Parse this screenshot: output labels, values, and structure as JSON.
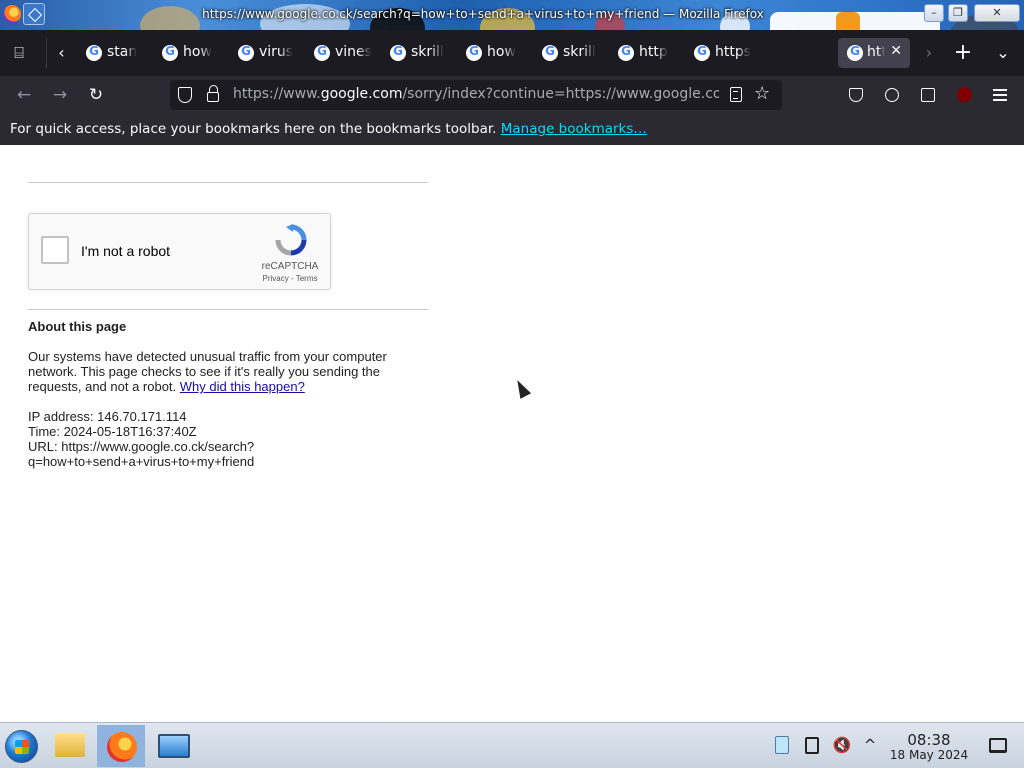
{
  "window": {
    "title": "https://www.google.co.ck/search?q=how+to+send+a+virus+to+my+friend — Mozilla Firefox",
    "minimize_label": "–",
    "maximize_label": "❐",
    "close_label": "✕"
  },
  "tabs": [
    {
      "label": "stan"
    },
    {
      "label": "how"
    },
    {
      "label": "virus"
    },
    {
      "label": "vines"
    },
    {
      "label": "skrill"
    },
    {
      "label": "how"
    },
    {
      "label": "skrill"
    },
    {
      "label": "http"
    },
    {
      "label": "https"
    }
  ],
  "active_tab": {
    "label": "htt",
    "close_label": "✕"
  },
  "tab_strip": {
    "list_all_label": "⌸",
    "scroll_left_label": "‹",
    "scroll_right_label": "›",
    "new_tab_label": "+",
    "overflow_label": "⌄"
  },
  "nav": {
    "back_label": "←",
    "forward_label": "→",
    "reload_label": "↻",
    "url_prefix": "https://www.",
    "url_host": "google.com",
    "url_rest": "/sorry/index?continue=https://www.google.co",
    "star_label": "☆"
  },
  "bookmarks": {
    "hint": "For quick access, place your bookmarks here on the bookmarks toolbar.",
    "manage_link": "Manage bookmarks…"
  },
  "page": {
    "recaptcha": {
      "checkbox_label": "I'm not a robot",
      "brand": "reCAPTCHA",
      "links": "Privacy - Terms"
    },
    "about_title": "About this page",
    "about_body": "Our systems have detected unusual traffic from your computer network. This page checks to see if it's really you sending the requests, and not a robot.",
    "why_link": "Why did this happen?",
    "ip_line": "IP address: 146.70.171.114",
    "time_line": "Time: 2024-05-18T16:37:40Z",
    "url_line_1": "URL: https://www.google.co.ck/search?",
    "url_line_2": "q=how+to+send+a+virus+to+my+friend"
  },
  "taskbar": {
    "volume_label": "🔇",
    "expand_label": "^",
    "clock_time": "08:38",
    "clock_date": "18 May 2024"
  },
  "colors": {
    "tab_strip_bg": "#1c1b22",
    "toolbar_bg": "#2b2a33",
    "link_cyan": "#00ddff",
    "link_blue": "#1a0dab",
    "recaptcha_blue": "#4a90e2"
  }
}
